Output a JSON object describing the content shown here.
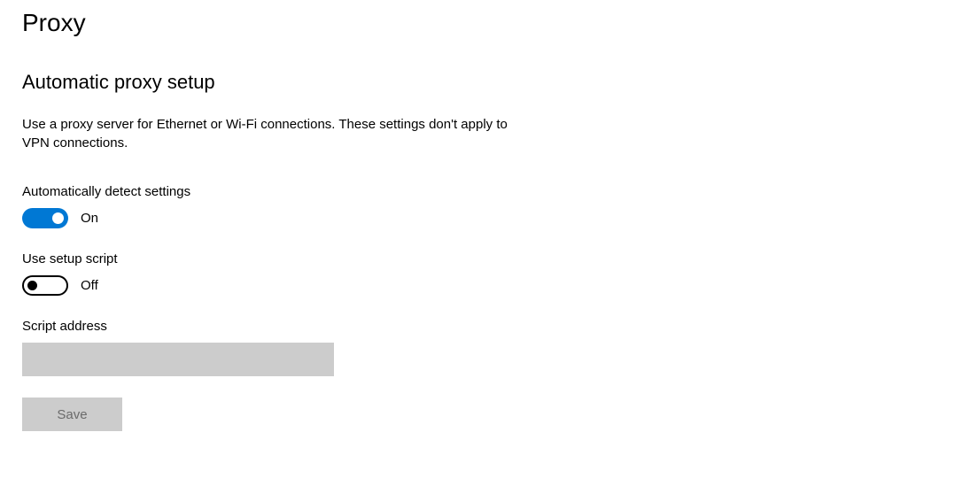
{
  "page": {
    "title": "Proxy"
  },
  "section": {
    "title": "Automatic proxy setup",
    "description": "Use a proxy server for Ethernet or Wi-Fi connections. These settings don't apply to VPN connections."
  },
  "settings": {
    "autoDetect": {
      "label": "Automatically detect settings",
      "stateLabel": "On",
      "on": true
    },
    "setupScript": {
      "label": "Use setup script",
      "stateLabel": "Off",
      "on": false
    },
    "scriptAddress": {
      "label": "Script address",
      "value": ""
    }
  },
  "buttons": {
    "save": "Save"
  }
}
